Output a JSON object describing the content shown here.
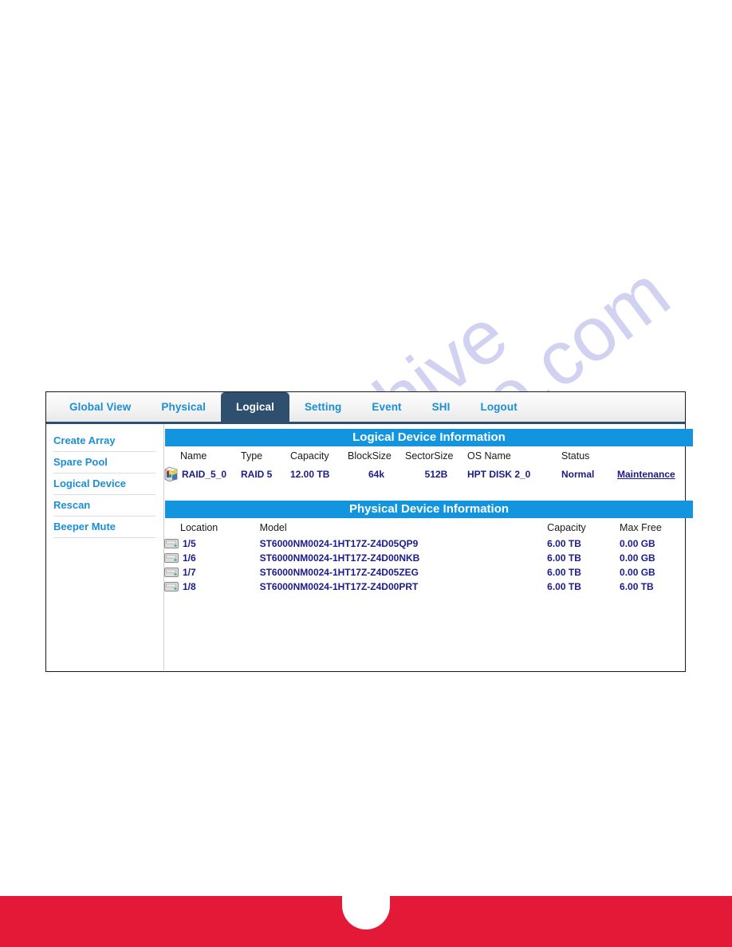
{
  "colors": {
    "accent_blue": "#1295de",
    "link_blue": "#1b8fd4",
    "active_tab_bg": "#2f4f6f",
    "data_navy": "#1b1b8a",
    "footer_red": "#e31937"
  },
  "watermark": {
    "line1": "manualshive",
    "line2": "e.com"
  },
  "tabs": [
    {
      "label": "Global View",
      "active": false
    },
    {
      "label": "Physical",
      "active": false
    },
    {
      "label": "Logical",
      "active": true
    },
    {
      "label": "Setting",
      "active": false
    },
    {
      "label": "Event",
      "active": false
    },
    {
      "label": "SHI",
      "active": false
    },
    {
      "label": "Logout",
      "active": false
    }
  ],
  "sidebar": {
    "items": [
      {
        "label": "Create Array"
      },
      {
        "label": "Spare Pool"
      },
      {
        "label": "Logical Device"
      },
      {
        "label": "Rescan"
      },
      {
        "label": "Beeper Mute"
      }
    ]
  },
  "logical_section": {
    "title": "Logical Device Information",
    "columns": [
      "Name",
      "Type",
      "Capacity",
      "BlockSize",
      "SectorSize",
      "OS Name",
      "Status",
      ""
    ],
    "rows": [
      {
        "icon": "raid-array-icon",
        "name": "RAID_5_0",
        "type": "RAID 5",
        "capacity": "12.00 TB",
        "block_size": "64k",
        "sector_size": "512B",
        "os_name": "HPT DISK 2_0",
        "status": "Normal",
        "action": "Maintenance"
      }
    ]
  },
  "physical_section": {
    "title": "Physical Device Information",
    "columns": [
      "Location",
      "Model",
      "Capacity",
      "Max Free"
    ],
    "rows": [
      {
        "icon": "hard-drive-icon",
        "location": "1/5",
        "model": "ST6000NM0024-1HT17Z-Z4D05QP9",
        "capacity": "6.00 TB",
        "max_free": "0.00 GB"
      },
      {
        "icon": "hard-drive-icon",
        "location": "1/6",
        "model": "ST6000NM0024-1HT17Z-Z4D00NKB",
        "capacity": "6.00 TB",
        "max_free": "0.00 GB"
      },
      {
        "icon": "hard-drive-icon",
        "location": "1/7",
        "model": "ST6000NM0024-1HT17Z-Z4D05ZEG",
        "capacity": "6.00 TB",
        "max_free": "0.00 GB"
      },
      {
        "icon": "hard-drive-icon",
        "location": "1/8",
        "model": "ST6000NM0024-1HT17Z-Z4D00PRT",
        "capacity": "6.00 TB",
        "max_free": "6.00 TB"
      }
    ]
  }
}
